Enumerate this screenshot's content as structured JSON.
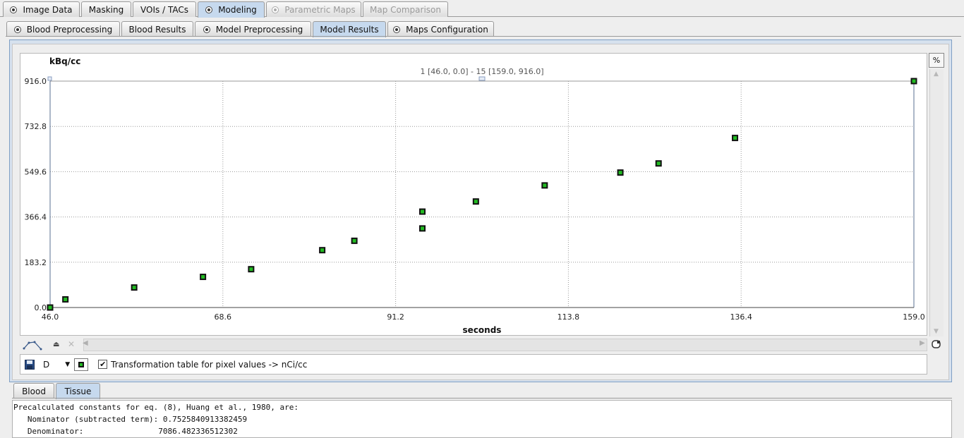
{
  "tabs_top": [
    {
      "label": "Image Data",
      "icon": "radio-dot-icon",
      "state": "normal"
    },
    {
      "label": "Masking",
      "icon": null,
      "state": "normal"
    },
    {
      "label": "VOIs / TACs",
      "icon": null,
      "state": "normal"
    },
    {
      "label": "Modeling",
      "icon": "radio-dot-icon",
      "state": "selected"
    },
    {
      "label": "Parametric Maps",
      "icon": "radio-dot-icon",
      "state": "disabled"
    },
    {
      "label": "Map Comparison",
      "icon": null,
      "state": "disabled"
    }
  ],
  "tabs_modeling": [
    {
      "label": "Blood Preprocessing",
      "icon": "radio-dot-icon",
      "state": "normal"
    },
    {
      "label": "Blood Results",
      "icon": null,
      "state": "normal"
    },
    {
      "label": "Model Preprocessing",
      "icon": "radio-dot-icon",
      "state": "normal"
    },
    {
      "label": "Model Results",
      "icon": null,
      "state": "selected"
    },
    {
      "label": "Maps Configuration",
      "icon": "radio-dot-icon",
      "state": "normal"
    }
  ],
  "plot": {
    "percent_button": "%",
    "range_readout": "1 [46.0, 0.0] - 15 [159.0, 916.0]"
  },
  "chart_data": {
    "type": "scatter",
    "title": "",
    "xlabel": "seconds",
    "ylabel": "kBq/cc",
    "xlim": [
      46.0,
      159.0
    ],
    "ylim": [
      0.0,
      916.0
    ],
    "xticks": [
      "46.0",
      "68.6",
      "91.2",
      "113.8",
      "136.4",
      "159.0"
    ],
    "yticks": [
      "0.0",
      "183.2",
      "366.4",
      "549.6",
      "732.8",
      "916.0"
    ],
    "grid": true,
    "marker_color": "#22bb22",
    "marker_edge": "#111111",
    "points": [
      [
        46.0,
        0.0
      ],
      [
        48.0,
        33.0
      ],
      [
        57.0,
        81.0
      ],
      [
        66.0,
        124.0
      ],
      [
        72.3,
        155.0
      ],
      [
        81.6,
        232.0
      ],
      [
        85.8,
        270.0
      ],
      [
        94.7,
        320.0
      ],
      [
        94.7,
        388.0
      ],
      [
        101.7,
        429.0
      ],
      [
        110.7,
        494.0
      ],
      [
        120.6,
        546.0
      ],
      [
        125.6,
        583.0
      ],
      [
        135.6,
        686.0
      ],
      [
        159.0,
        916.0
      ]
    ]
  },
  "toolbar": {
    "curve_label": "D",
    "transform_checked": true,
    "transform_label": "Transformation table for pixel values -> nCi/cc"
  },
  "tabs_bottom": [
    {
      "label": "Blood",
      "state": "normal"
    },
    {
      "label": "Tissue",
      "state": "selected"
    }
  ],
  "results_text": {
    "line1": "Precalculated constants for eq. (8), Huang et al., 1980, are:",
    "line2": "   Nominator (subtracted term): 0.7525840913382459",
    "line3": "   Denominator:                7086.482336512302"
  }
}
